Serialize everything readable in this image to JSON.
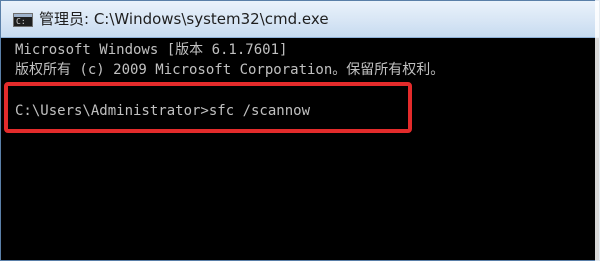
{
  "window": {
    "title": "管理员: C:\\Windows\\system32\\cmd.exe",
    "icon": "cmd-icon"
  },
  "console": {
    "lines": [
      "Microsoft Windows [版本 6.1.7601]",
      "版权所有 (c) 2009 Microsoft Corporation。保留所有权利。",
      "C:\\Users\\Administrator>sfc /scannow"
    ]
  },
  "colors": {
    "console_background": "#000000",
    "console_text": "#c0c0c0",
    "highlight": "#e32b2b",
    "titlebar": "#dbe8f6"
  }
}
